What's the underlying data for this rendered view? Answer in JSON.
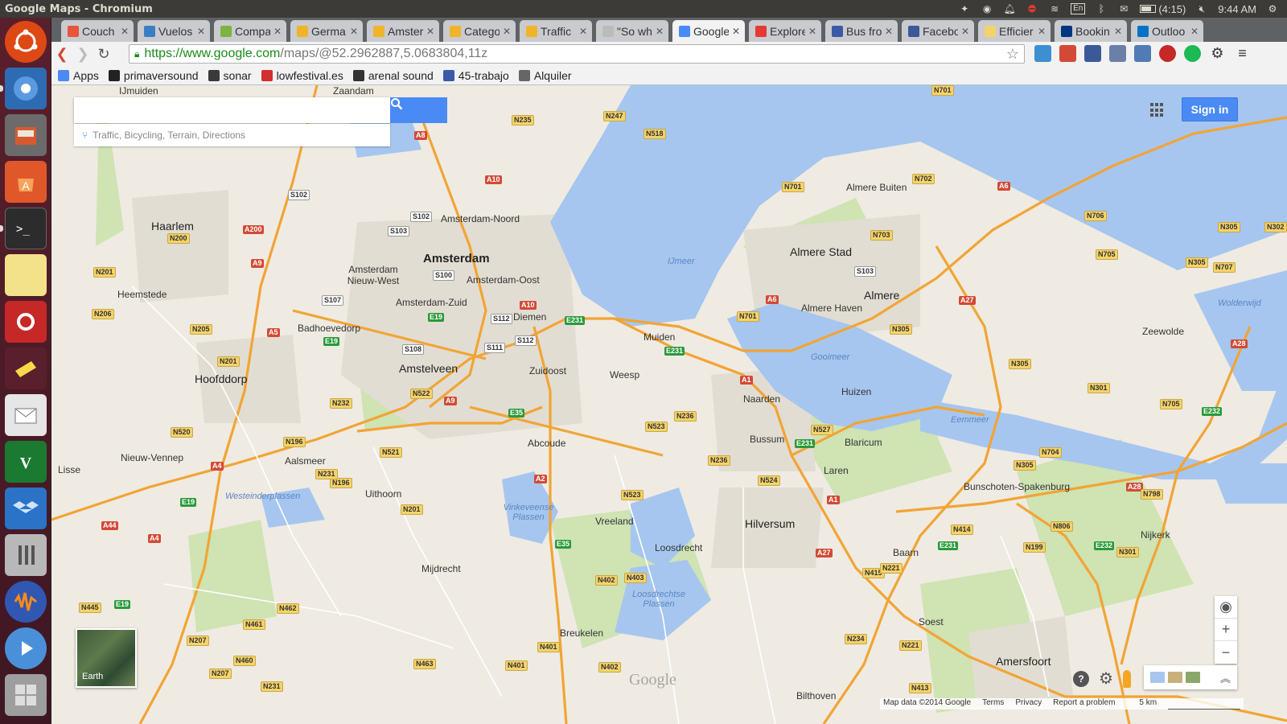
{
  "window": {
    "title": "Google Maps - Chromium"
  },
  "tray": {
    "lang": "En",
    "battery": "(4:15)",
    "battery_level": 0.75,
    "clock": "9:44 AM"
  },
  "tabs": [
    {
      "label": "Couch",
      "color": "#e8543c"
    },
    {
      "label": "Vuelos",
      "color": "#3a7fc4"
    },
    {
      "label": "Compa",
      "color": "#7cb342"
    },
    {
      "label": "Germa",
      "color": "#f0b429"
    },
    {
      "label": "Amster",
      "color": "#f0b429"
    },
    {
      "label": "Catego",
      "color": "#f0b429"
    },
    {
      "label": "Traffic",
      "color": "#f0b429"
    },
    {
      "label": "\"So wh",
      "color": "#bbbbbb"
    },
    {
      "label": "Google",
      "color": "#4a8af4"
    },
    {
      "label": "Explore",
      "color": "#e53935"
    },
    {
      "label": "Bus fro",
      "color": "#3a5aa8"
    },
    {
      "label": "Facebo",
      "color": "#3b5998"
    },
    {
      "label": "Efficier",
      "color": "#f5d36a"
    },
    {
      "label": "Bookin",
      "color": "#003580"
    },
    {
      "label": "Outloo",
      "color": "#0072c6"
    }
  ],
  "omnibox": {
    "scheme": "https://",
    "host": "www.google.com",
    "path": "/maps/@52.2962887,5.0683804,11z"
  },
  "bookmarks": [
    {
      "label": "Apps",
      "color": "#4a8af4"
    },
    {
      "label": "primaversound",
      "color": "#222222"
    },
    {
      "label": "sonar",
      "color": "#3a3a3a"
    },
    {
      "label": "lowfestival.es",
      "color": "#d32f2f"
    },
    {
      "label": "arenal sound",
      "color": "#333333"
    },
    {
      "label": "45-trabajo",
      "color": "#3a5aa8"
    },
    {
      "label": "Alquiler",
      "color": "#666666"
    }
  ],
  "map": {
    "search_value": "",
    "suggest_text": "Traffic, Bicycling, Terrain, Directions",
    "signin": "Sign in",
    "earth_label": "Earth",
    "help": "?",
    "watermark": "Google",
    "footer": [
      "Map data ©2014 Google",
      "Terms",
      "Privacy",
      "Report a problem"
    ],
    "scale": "5 km",
    "colors": {
      "water": "#a6c6ef",
      "highway": "#f2a435",
      "land": "#efebe2",
      "green": "#cfe3b3"
    },
    "places": {
      "amsterdam": "Amsterdam",
      "haarlem": "Haarlem",
      "hoofddorp": "Hoofddorp",
      "amstelveen": "Amstelveen",
      "almere_stad": "Almere Stad",
      "almere": "Almere",
      "almere_buiten": "Almere Buiten",
      "almere_haven": "Almere Haven",
      "hilversum": "Hilversum",
      "huizen": "Huizen",
      "naarden": "Naarden",
      "bussum": "Bussum",
      "amersfoort": "Amersfoort",
      "baarn": "Baarn",
      "soest": "Soest",
      "aalsmeer": "Aalsmeer",
      "nieuw_vennep": "Nieuw-Vennep",
      "uithoorn": "Uithoorn",
      "mijdrecht": "Mijdrecht",
      "weesp": "Weesp",
      "zaandam": "Zaandam",
      "ijmuiden": "IJmuiden",
      "diemen": "Diemen",
      "zuidoost": "Zuidoost",
      "amsterdam_noord": "Amsterdam-Noord",
      "amsterdam_oost": "Amsterdam-Oost",
      "amsterdam_zuid": "Amsterdam-Zuid",
      "amsterdam_nieuw_west": "Amsterdam Nieuw-West",
      "badhoevedorp": "Badhoevedorp",
      "heemstede": "Heemstede",
      "bunschoten": "Bunschoten-Spakenburg",
      "nijkerk": "Nijkerk",
      "laren": "Laren",
      "blaricum": "Blaricum",
      "zeewolde": "Zeewolde",
      "lisse": "Lisse",
      "muiden": "Muiden",
      "abcoude": "Abcoude",
      "loosdrecht": "Loosdrecht",
      "breukelen": "Breukelen",
      "bilthoven": "Bilthoven",
      "vreeland": "Vreeland"
    },
    "water": {
      "ijmeer": "IJmeer",
      "gooimeer": "Gooimeer",
      "eemmeer": "Eemmeer",
      "wolderwijd": "Wolderwijd",
      "vinkeveense": "Vinkeveense Plassen",
      "loosdrechtse": "Loosdrechtse Plassen",
      "westeinder": "Westeinderplassen"
    }
  }
}
